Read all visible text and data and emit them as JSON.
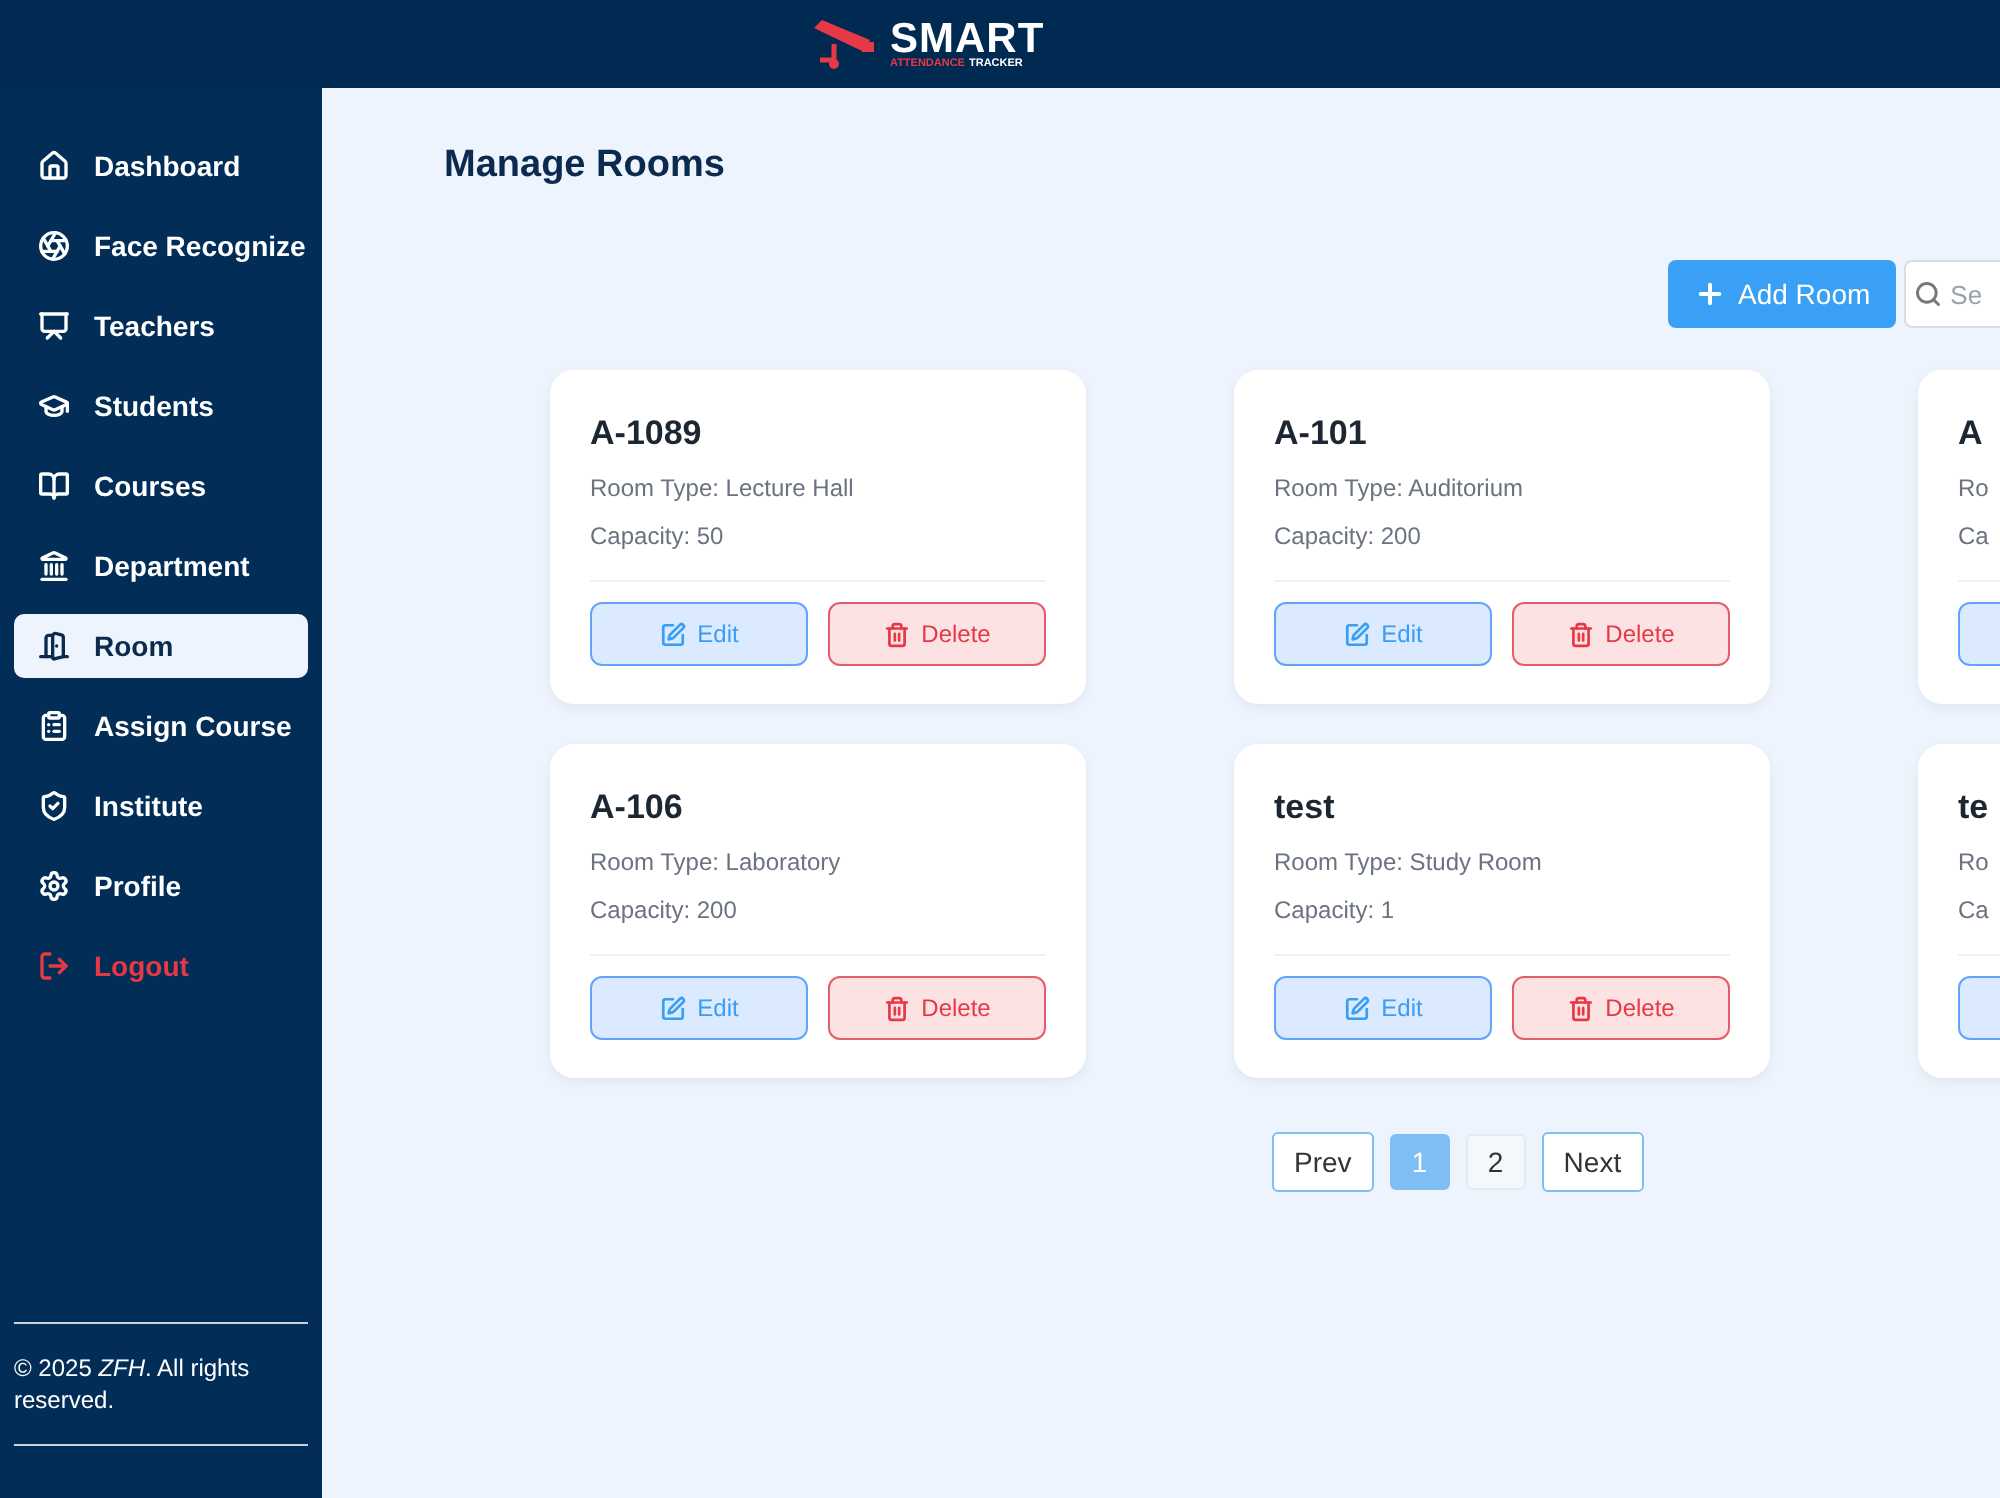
{
  "header": {
    "brand": "SMART",
    "tagline_accent": "ATTENDANCE",
    "tagline": "TRACKER"
  },
  "sidebar": {
    "items": [
      {
        "label": "Dashboard",
        "selected": false,
        "kind": "nav"
      },
      {
        "label": "Face Recognize",
        "selected": false,
        "kind": "nav"
      },
      {
        "label": "Teachers",
        "selected": false,
        "kind": "nav"
      },
      {
        "label": "Students",
        "selected": false,
        "kind": "nav"
      },
      {
        "label": "Courses",
        "selected": false,
        "kind": "nav"
      },
      {
        "label": "Department",
        "selected": false,
        "kind": "nav"
      },
      {
        "label": "Room",
        "selected": true,
        "kind": "nav"
      },
      {
        "label": "Assign Course",
        "selected": false,
        "kind": "nav"
      },
      {
        "label": "Institute",
        "selected": false,
        "kind": "nav"
      },
      {
        "label": "Profile",
        "selected": false,
        "kind": "nav"
      },
      {
        "label": "Logout",
        "selected": false,
        "kind": "danger"
      }
    ],
    "footer": "© 2025 *ZFH*. All rights reserved."
  },
  "page": {
    "title": "Manage Rooms",
    "add_button": "Add Room",
    "search": {
      "placeholder": "Se"
    }
  },
  "rooms": [
    {
      "title": "A-1089",
      "room_type": "Room Type: Lecture Hall",
      "capacity": "Capacity: 50",
      "actions": [
        {
          "kind": "edit",
          "label": "Edit"
        },
        {
          "kind": "delete",
          "label": "Delete"
        }
      ]
    },
    {
      "title": "A-101",
      "room_type": "Room Type: Auditorium",
      "capacity": "Capacity: 200",
      "actions": [
        {
          "kind": "edit",
          "label": "Edit"
        },
        {
          "kind": "delete",
          "label": "Delete"
        }
      ]
    },
    {
      "title": "A",
      "room_type": "Ro",
      "capacity": "Ca",
      "actions": [
        {
          "kind": "edit"
        }
      ]
    },
    {
      "title": "A-106",
      "room_type": "Room Type: Laboratory",
      "capacity": "Capacity: 200",
      "actions": [
        {
          "kind": "edit",
          "label": "Edit"
        },
        {
          "kind": "delete",
          "label": "Delete"
        }
      ]
    },
    {
      "title": "test",
      "room_type": "Room Type: Study Room",
      "capacity": "Capacity: 1",
      "actions": [
        {
          "kind": "edit",
          "label": "Edit"
        },
        {
          "kind": "delete",
          "label": "Delete"
        }
      ]
    },
    {
      "title": "te",
      "room_type": "Ro",
      "capacity": "Ca",
      "actions": [
        {
          "kind": "edit"
        }
      ]
    }
  ],
  "pagination": {
    "prev": "Prev",
    "next": "Next",
    "pages": [
      {
        "label": "1",
        "selected": true
      },
      {
        "label": "2",
        "selected": false
      }
    ]
  }
}
